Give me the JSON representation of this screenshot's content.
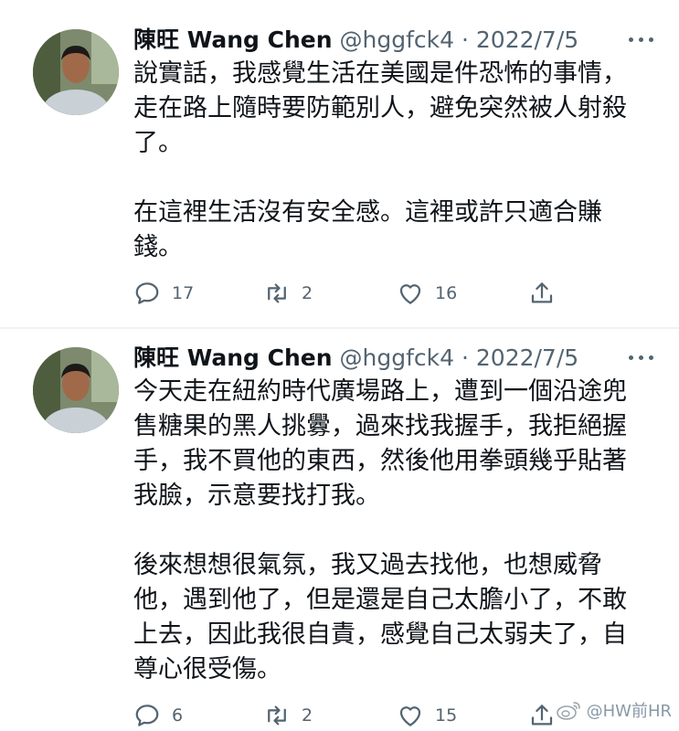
{
  "tweets": [
    {
      "display_name": "陳旺 Wang Chen",
      "handle": "@hggfck4",
      "separator": "·",
      "date": "2022/7/5",
      "paragraphs": [
        "說實話，我感覺生活在美國是件恐怖的事情，走在路上隨時要防範別人，避免突然被人射殺了。",
        "在這裡生活沒有安全感。這裡或許只適合賺錢。"
      ],
      "replies": "17",
      "retweets": "2",
      "likes": "16"
    },
    {
      "display_name": "陳旺 Wang Chen",
      "handle": "@hggfck4",
      "separator": "·",
      "date": "2022/7/5",
      "paragraphs": [
        "今天走在紐約時代廣場路上，遭到一個沿途兜售糖果的黑人挑釁，過來找我握手，我拒絕握手，我不買他的東西，然後他用拳頭幾乎貼著我臉，示意要找打我。",
        "後來想想很氣氛，我又過去找他，也想威脅他，遇到他了，但是還是自己太膽小了，不敢上去，因此我很自責，感覺自己太弱夫了，自尊心很受傷。"
      ],
      "replies": "6",
      "retweets": "2",
      "likes": "15"
    }
  ],
  "watermark": {
    "text": "@HW前HR",
    "icon": "weibo-logo-icon"
  },
  "colors": {
    "text": "#0f1419",
    "secondary": "#536471",
    "divider": "#eff3f4"
  }
}
